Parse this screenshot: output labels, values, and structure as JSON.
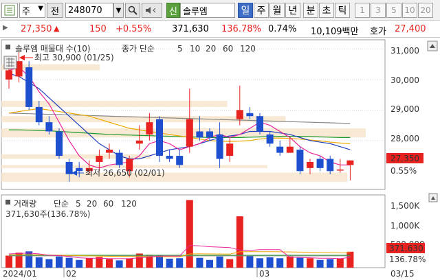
{
  "toolbar": {
    "period_type": "주",
    "mode_label": "전",
    "stock_code": "248070",
    "link_label": "신",
    "stock_name": "솔루엠",
    "period_tabs": [
      "일",
      "주",
      "월",
      "년",
      "분",
      "초",
      "틱"
    ],
    "active_tab": "일",
    "interval_tabs": [
      "1",
      "3",
      "5",
      "10",
      "20"
    ]
  },
  "info": {
    "price": "27,350",
    "change": "150",
    "change_pct": "+0.55%",
    "volume": "371,630",
    "volume_ratio": "136.78%",
    "turnover_rate": "0.74%",
    "trade_value": "10,109백만",
    "ask_label": "호가",
    "ask_price": "27,400"
  },
  "price_panel": {
    "legend_title": "솔루엠 매물대 수(10)",
    "ma_legend": {
      "label": "종가 단순",
      "periods": [
        "5",
        "10",
        "20",
        "60",
        "120"
      ]
    },
    "high_annotation": "최고 30,900 (01/25)",
    "low_annotation": "최저 26,650 (02/01)",
    "y_ticks": [
      "31,000",
      "30,000",
      "29,000",
      "28,000"
    ],
    "current_price_tag": "27,350",
    "current_change_tag": "0.55%"
  },
  "volume_panel": {
    "legend_label": "거래량",
    "ma_legend": {
      "label": "단순",
      "periods": [
        "5",
        "20",
        "60",
        "120"
      ]
    },
    "summary": "371,630주(136.78%)",
    "y_ticks": [
      "1,500K",
      "1,000K",
      "500,000"
    ],
    "current_volume_tag": "371,630",
    "current_ratio_tag": "136.78%"
  },
  "x_axis": {
    "labels": [
      "2024/01",
      "02",
      "03",
      "03/15"
    ]
  },
  "colors": {
    "up": "#e8221f",
    "down": "#1d4fce",
    "ma5": "#e8229a",
    "ma10": "#1f3fbf",
    "ma20": "#f0a800",
    "ma60": "#1e9a2e",
    "ma120": "#888888",
    "tab_active": "#3d6cc6"
  },
  "chart_data": {
    "type": "candlestick",
    "ylim": [
      26400,
      31300
    ],
    "candles": [
      {
        "o": 30000,
        "h": 30400,
        "l": 29700,
        "c": 30300
      },
      {
        "o": 30100,
        "h": 30900,
        "l": 29900,
        "c": 30600
      },
      {
        "o": 30400,
        "h": 30600,
        "l": 29000,
        "c": 29100
      },
      {
        "o": 29100,
        "h": 29300,
        "l": 28500,
        "c": 28600
      },
      {
        "o": 28600,
        "h": 28800,
        "l": 28200,
        "c": 28300
      },
      {
        "o": 28300,
        "h": 28400,
        "l": 27400,
        "c": 27500
      },
      {
        "o": 27300,
        "h": 27400,
        "l": 26650,
        "c": 26900
      },
      {
        "o": 27100,
        "h": 27300,
        "l": 26800,
        "c": 27000
      },
      {
        "o": 27000,
        "h": 27350,
        "l": 26900,
        "c": 27100
      },
      {
        "o": 27300,
        "h": 27700,
        "l": 27000,
        "c": 27500
      },
      {
        "o": 27600,
        "h": 27900,
        "l": 27400,
        "c": 27700
      },
      {
        "o": 27600,
        "h": 27700,
        "l": 27100,
        "c": 27200
      },
      {
        "o": 27000,
        "h": 27500,
        "l": 26800,
        "c": 27400
      },
      {
        "o": 27900,
        "h": 28500,
        "l": 27700,
        "c": 28000
      },
      {
        "o": 28200,
        "h": 28900,
        "l": 28000,
        "c": 28600
      },
      {
        "o": 28700,
        "h": 28800,
        "l": 27300,
        "c": 27500
      },
      {
        "o": 27500,
        "h": 27700,
        "l": 27300,
        "c": 27400
      },
      {
        "o": 27500,
        "h": 27700,
        "l": 27100,
        "c": 27200
      },
      {
        "o": 27800,
        "h": 29700,
        "l": 27600,
        "c": 28700
      },
      {
        "o": 28300,
        "h": 28800,
        "l": 28000,
        "c": 28100
      },
      {
        "o": 28300,
        "h": 28400,
        "l": 28000,
        "c": 28100
      },
      {
        "o": 28200,
        "h": 28600,
        "l": 27100,
        "c": 27400
      },
      {
        "o": 27500,
        "h": 28100,
        "l": 27300,
        "c": 27900
      },
      {
        "o": 28700,
        "h": 29800,
        "l": 28500,
        "c": 29000
      },
      {
        "o": 28900,
        "h": 29100,
        "l": 28700,
        "c": 28800
      },
      {
        "o": 28800,
        "h": 28900,
        "l": 28200,
        "c": 28300
      },
      {
        "o": 28200,
        "h": 28300,
        "l": 27800,
        "c": 27900
      },
      {
        "o": 27800,
        "h": 28000,
        "l": 27500,
        "c": 27600
      },
      {
        "o": 27600,
        "h": 28100,
        "l": 27600,
        "c": 27800
      },
      {
        "o": 27700,
        "h": 27800,
        "l": 26900,
        "c": 27000
      },
      {
        "o": 27100,
        "h": 27400,
        "l": 26900,
        "c": 27300
      },
      {
        "o": 27400,
        "h": 27500,
        "l": 27000,
        "c": 27100
      },
      {
        "o": 27400,
        "h": 27500,
        "l": 26900,
        "c": 27000
      },
      {
        "o": 27050,
        "h": 27400,
        "l": 26950,
        "c": 27050
      },
      {
        "o": 27200,
        "h": 27350,
        "l": 26700,
        "c": 27350
      }
    ],
    "ma5": [
      30300,
      30400,
      30100,
      29600,
      29200,
      28600,
      28000,
      27500,
      27200,
      27100,
      27200,
      27250,
      27300,
      27500,
      27900,
      28000,
      27900,
      27700,
      27800,
      27900,
      28100,
      28200,
      28100,
      28200,
      28400,
      28600,
      28500,
      28300,
      28100,
      27800,
      27600,
      27500,
      27300,
      27200,
      27200
    ],
    "ma10": [
      30200,
      30100,
      29900,
      29700,
      29400,
      29100,
      28800,
      28500,
      28200,
      27900,
      27700,
      27500,
      27400,
      27400,
      27500,
      27600,
      27700,
      27750,
      27800,
      27900,
      28000,
      28100,
      28150,
      28200,
      28300,
      28300,
      28300,
      28250,
      28200,
      28100,
      28000,
      27950,
      27900,
      27800,
      27700
    ],
    "ma20": [
      28900,
      28950,
      29000,
      29050,
      29000,
      28950,
      28900,
      28850,
      28800,
      28700,
      28600,
      28500,
      28400,
      28350,
      28300,
      28250,
      28200,
      28150,
      28100,
      28050,
      28000,
      27980,
      27970,
      27980,
      28000,
      28050,
      28080,
      28080,
      28070,
      28050,
      28020,
      27990,
      27950,
      27920,
      27900
    ],
    "ma60": [
      28350,
      28350,
      28340,
      28330,
      28320,
      28300,
      28280,
      28260,
      28240,
      28220,
      28200,
      28190,
      28180,
      28170,
      28160,
      28150,
      28140,
      28130,
      28120,
      28110,
      28100,
      28100,
      28100,
      28100,
      28110,
      28120,
      28130,
      28140,
      28140,
      28140,
      28130,
      28120,
      28110,
      28100,
      28100
    ],
    "ma120": [
      28900,
      28890,
      28880,
      28870,
      28860,
      28850,
      28840,
      28830,
      28820,
      28810,
      28800,
      28790,
      28780,
      28770,
      28760,
      28750,
      28740,
      28730,
      28720,
      28710,
      28700,
      28690,
      28680,
      28670,
      28660,
      28650,
      28640,
      28630,
      28620,
      28610,
      28600,
      28590,
      28580,
      28570,
      28560
    ],
    "volume_profile": [
      {
        "lo": 30300,
        "hi": 30500,
        "len": 0.27
      },
      {
        "lo": 29100,
        "hi": 29300,
        "len": 0.62
      },
      {
        "lo": 28600,
        "hi": 28800,
        "len": 0.78
      },
      {
        "lo": 28100,
        "hi": 28400,
        "len": 1.0
      },
      {
        "lo": 27400,
        "hi": 27550,
        "len": 0.41
      },
      {
        "lo": 27100,
        "hi": 27200,
        "len": 0.73
      },
      {
        "lo": 26650,
        "hi": 26950,
        "len": 0.95
      }
    ],
    "volume_ylim": [
      0,
      1700000
    ],
    "volumes": [
      280000,
      350000,
      380000,
      240000,
      200000,
      260000,
      230000,
      180000,
      220000,
      250000,
      200000,
      170000,
      210000,
      330000,
      300000,
      290000,
      210000,
      220000,
      1580000,
      230000,
      180000,
      260000,
      200000,
      1200000,
      280000,
      220000,
      240000,
      220000,
      260000,
      230000,
      220000,
      180000,
      200000,
      210000,
      371630
    ],
    "vol_ma5": [
      320000,
      330000,
      340000,
      320000,
      290000,
      280000,
      260000,
      230000,
      220000,
      220000,
      210000,
      210000,
      210000,
      230000,
      250000,
      270000,
      270000,
      270000,
      520000,
      510000,
      490000,
      480000,
      470000,
      410000,
      400000,
      420000,
      420000,
      420000,
      240000,
      240000,
      230000,
      220000,
      220000,
      210000,
      240000
    ],
    "vol_ma20": [
      300000,
      300000,
      305000,
      300000,
      295000,
      290000,
      285000,
      280000,
      275000,
      270000,
      265000,
      262000,
      260000,
      258000,
      256000,
      255000,
      254000,
      252000,
      320000,
      322000,
      320000,
      318000,
      316000,
      370000,
      372000,
      372000,
      372000,
      370000,
      366000,
      362000,
      358000,
      354000,
      350000,
      346000,
      345000
    ],
    "vol_ma60": [
      290000,
      290000,
      290000,
      290000,
      290000,
      290000,
      290000,
      290000,
      290000,
      290000,
      290000,
      290000,
      290000,
      290000,
      290000,
      290000,
      290000,
      290000,
      290000,
      290000,
      290000,
      290000,
      290000,
      290000,
      290000,
      290000,
      290000,
      290000,
      290000,
      290000,
      290000,
      290000,
      290000,
      290000,
      290000
    ],
    "vol_ma120": [
      275000,
      275000,
      275000,
      275000,
      275000,
      275000,
      275000,
      275000,
      275000,
      275000,
      275000,
      275000,
      275000,
      275000,
      275000,
      275000,
      275000,
      275000,
      275000,
      275000,
      275000,
      275000,
      275000,
      275000,
      275000,
      275000,
      275000,
      275000,
      275000,
      275000,
      275000,
      275000,
      275000,
      275000,
      275000
    ]
  }
}
